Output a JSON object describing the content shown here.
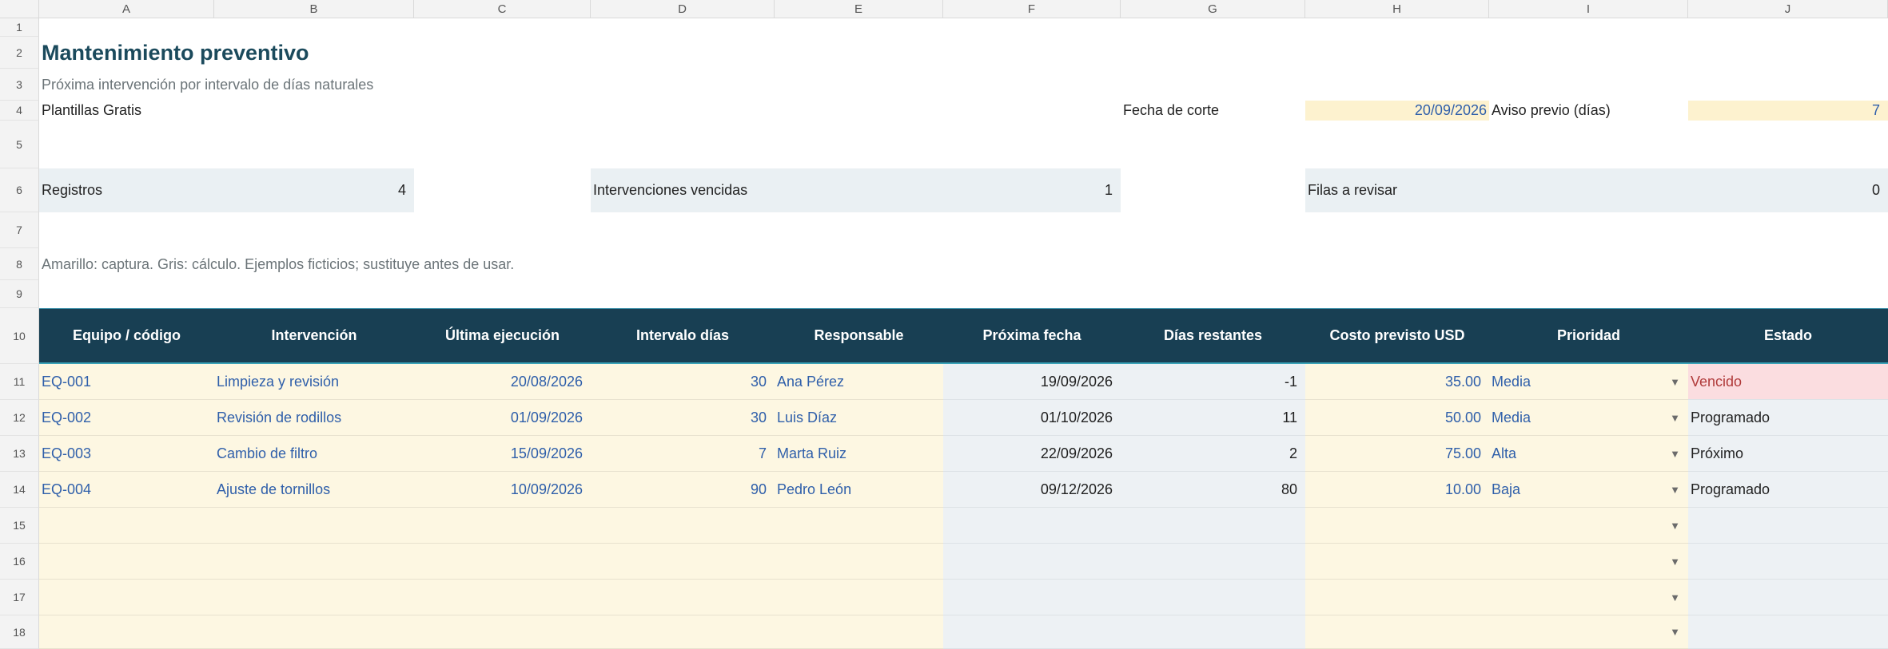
{
  "columns": [
    "A",
    "B",
    "C",
    "D",
    "E",
    "F",
    "G",
    "H",
    "I",
    "J"
  ],
  "rows": [
    "1",
    "2",
    "3",
    "4",
    "5",
    "6",
    "7",
    "8",
    "9",
    "10",
    "11",
    "12",
    "13",
    "14",
    "15",
    "16",
    "17",
    "18"
  ],
  "title": "Mantenimiento preventivo",
  "subtitle": "Próxima intervención por intervalo de días naturales",
  "brand": "Plantillas Gratis",
  "params": {
    "cutoff_label": "Fecha de corte",
    "cutoff_value": "20/09/2026",
    "notice_label": "Aviso previo (días)",
    "notice_value": "7"
  },
  "kpis": {
    "registros_label": "Registros",
    "registros_value": "4",
    "vencidas_label": "Intervenciones vencidas",
    "vencidas_value": "1",
    "revisar_label": "Filas a revisar",
    "revisar_value": "0"
  },
  "note": "Amarillo: captura. Gris: cálculo. Ejemplos ficticios; sustituye antes de usar.",
  "table": {
    "headers": [
      "Equipo / código",
      "Intervención",
      "Última ejecución",
      "Intervalo días",
      "Responsable",
      "Próxima fecha",
      "Días restantes",
      "Costo previsto USD",
      "Prioridad",
      "Estado"
    ],
    "rows": [
      {
        "equipo": "EQ-001",
        "intervencion": "Limpieza y revisión",
        "ultima": "20/08/2026",
        "intervalo": "30",
        "responsable": "Ana Pérez",
        "proxima": "19/09/2026",
        "dias": "-1",
        "costo": "35.00",
        "prioridad": "Media",
        "estado": "Vencido"
      },
      {
        "equipo": "EQ-002",
        "intervencion": "Revisión de rodillos",
        "ultima": "01/09/2026",
        "intervalo": "30",
        "responsable": "Luis Díaz",
        "proxima": "01/10/2026",
        "dias": "11",
        "costo": "50.00",
        "prioridad": "Media",
        "estado": "Programado"
      },
      {
        "equipo": "EQ-003",
        "intervencion": "Cambio de filtro",
        "ultima": "15/09/2026",
        "intervalo": "7",
        "responsable": "Marta Ruiz",
        "proxima": "22/09/2026",
        "dias": "2",
        "costo": "75.00",
        "prioridad": "Alta",
        "estado": "Próximo"
      },
      {
        "equipo": "EQ-004",
        "intervencion": "Ajuste de tornillos",
        "ultima": "10/09/2026",
        "intervalo": "90",
        "responsable": "Pedro León",
        "proxima": "09/12/2026",
        "dias": "80",
        "costo": "10.00",
        "prioridad": "Baja",
        "estado": "Programado"
      }
    ],
    "empty_rows": 4
  },
  "colors": {
    "header_bg": "#183f53",
    "title": "#1b4a5c",
    "input_bg": "#fdf2cf",
    "capture_bg": "#fdf7e2",
    "calc_bg": "#edf1f4",
    "kpi_bg": "#eaf0f3",
    "overdue_bg": "#fbdde0",
    "overdue_text": "#b03a3a",
    "input_text": "#2f5faa"
  },
  "icons": {
    "dropdown": "dropdown-arrow-icon"
  }
}
